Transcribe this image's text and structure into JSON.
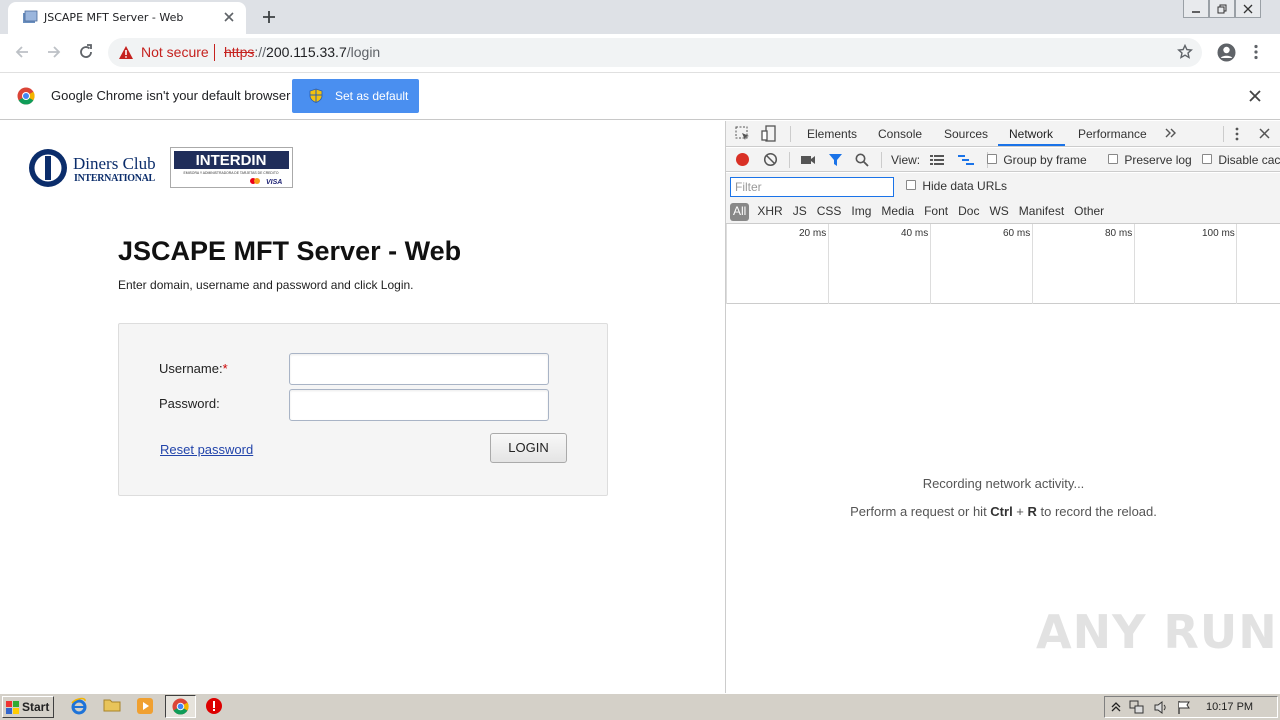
{
  "browser": {
    "tab_title": "JSCAPE MFT Server - Web",
    "security_label": "Not secure",
    "url_scheme": "https",
    "url_sep": "://",
    "url_host": "200.115.33.7",
    "url_path": "/login"
  },
  "infobar": {
    "message": "Google Chrome isn't your default browser",
    "button": "Set as default"
  },
  "page": {
    "logo_left_line1": "Diners Club",
    "logo_left_line2": "INTERNATIONAL",
    "logo_right_text": "INTERDIN",
    "logo_right_sub": "EMISORA Y ADMINISTRADORA DE TARJETAS DE CREDITO",
    "logo_right_visa": "VISA",
    "title": "JSCAPE MFT Server - Web",
    "subtitle": "Enter domain, username and password and click Login.",
    "username_label": "Username:",
    "required_mark": "*",
    "password_label": "Password:",
    "reset_link": "Reset password",
    "login_button": "LOGIN"
  },
  "devtools": {
    "tabs": [
      "Elements",
      "Console",
      "Sources",
      "Network",
      "Performance"
    ],
    "active_tab": "Network",
    "view_label": "View:",
    "group_by_frame": "Group by frame",
    "preserve_log": "Preserve log",
    "disable_cache": "Disable cac",
    "filter_placeholder": "Filter",
    "hide_data_urls": "Hide data URLs",
    "type_filters": [
      "All",
      "XHR",
      "JS",
      "CSS",
      "Img",
      "Media",
      "Font",
      "Doc",
      "WS",
      "Manifest",
      "Other"
    ],
    "ticks": [
      "20 ms",
      "40 ms",
      "60 ms",
      "80 ms",
      "100 ms"
    ],
    "recording_line1": "Recording network activity...",
    "recording_line2_pre": "Perform a request or hit ",
    "recording_ctrl": "Ctrl",
    "recording_plus": " + ",
    "recording_r": "R",
    "recording_line2_post": " to record the reload."
  },
  "watermark": "ANY RUN",
  "taskbar": {
    "start": "Start",
    "clock": "10:17 PM"
  },
  "colors": {
    "accent_blue": "#1a73e8",
    "insecure_red": "#c5221f",
    "setdefault_blue": "#4a8ff0"
  }
}
